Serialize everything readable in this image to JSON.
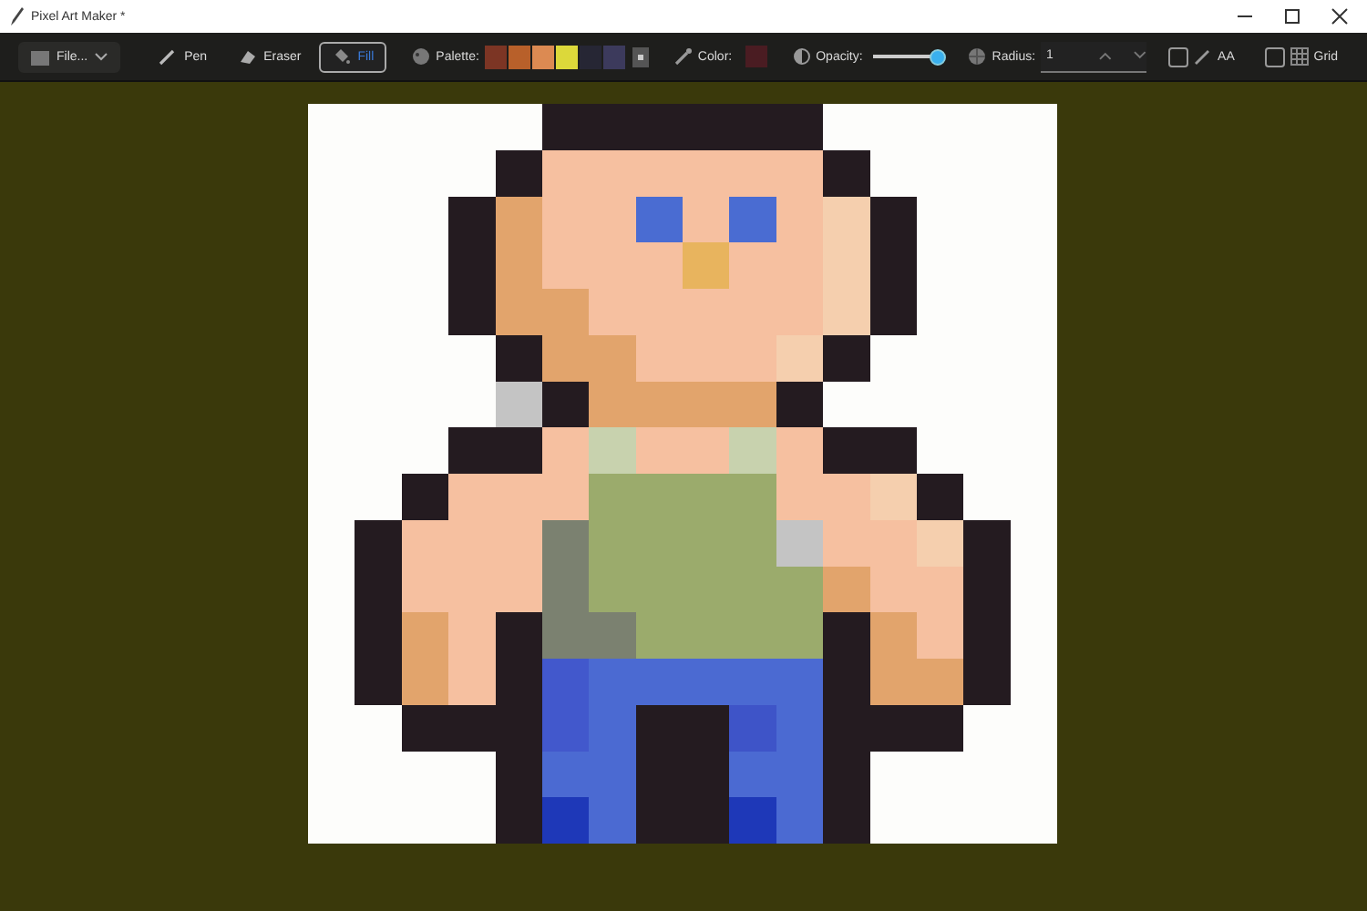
{
  "window": {
    "title": "Pixel Art Maker *"
  },
  "toolbar": {
    "file_menu": {
      "label": "File..."
    },
    "tools": [
      {
        "label": "Pen",
        "kind": "pen",
        "selected": false
      },
      {
        "label": "Eraser",
        "kind": "eraser",
        "selected": false
      },
      {
        "label": "Fill",
        "kind": "fill",
        "selected": true
      }
    ],
    "palette": {
      "label": "Palette:",
      "swatches": [
        {
          "color": "#7c3524"
        },
        {
          "color": "#b8602a"
        },
        {
          "color": "#dc8a52"
        },
        {
          "color": "#dcd83a"
        },
        {
          "color": "#262634"
        },
        {
          "color": "#3c3a5c"
        }
      ]
    },
    "color": {
      "label": "Color:",
      "color": "#4a1c22"
    },
    "opacity": {
      "label": "Opacity:",
      "level": 0.95
    },
    "radius": {
      "label": "Radius:",
      "value": "1"
    },
    "options": [
      {
        "label": "AA",
        "kind": "aa",
        "checked": false
      },
      {
        "label": "Grid",
        "kind": "grid",
        "checked": false
      }
    ]
  }
}
